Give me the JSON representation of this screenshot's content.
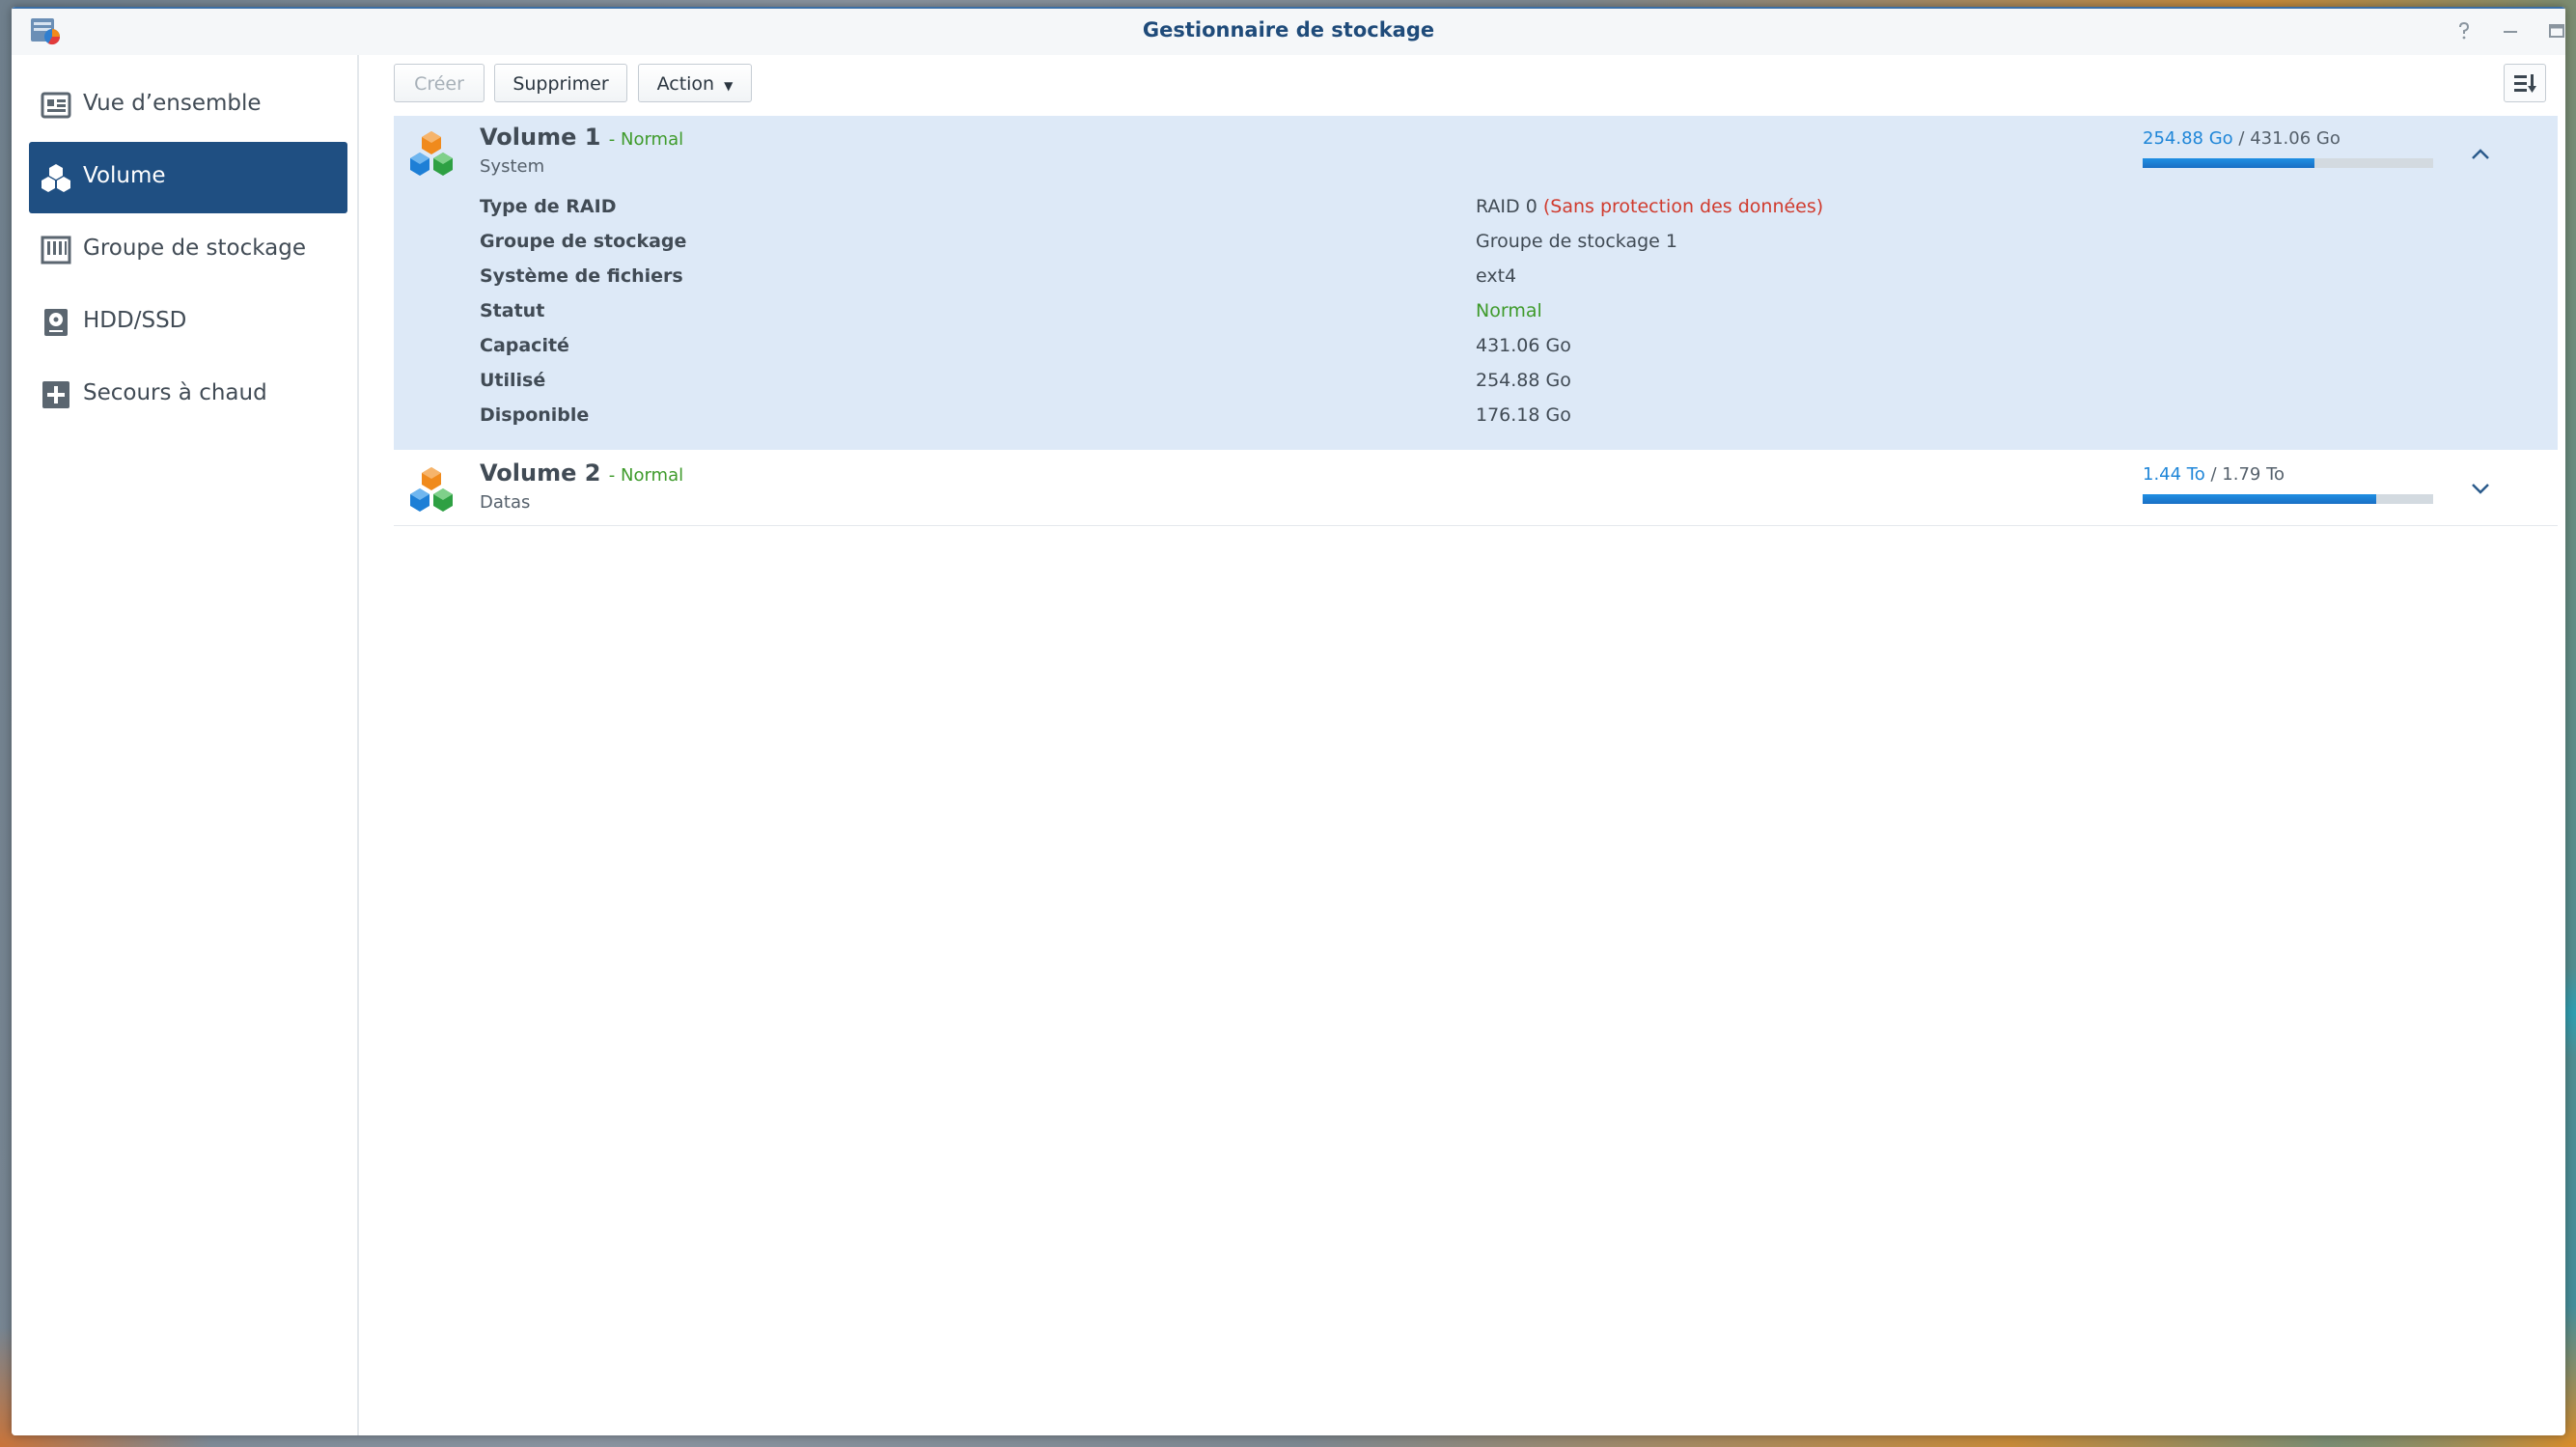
{
  "window": {
    "title": "Gestionnaire de stockage"
  },
  "sidebar": {
    "items": [
      {
        "label": "Vue d’ensemble",
        "icon": "overview-icon",
        "active": false
      },
      {
        "label": "Volume",
        "icon": "volume-cubes-icon",
        "active": true
      },
      {
        "label": "Groupe de stockage",
        "icon": "storage-pool-icon",
        "active": false
      },
      {
        "label": "HDD/SSD",
        "icon": "disk-icon",
        "active": false
      },
      {
        "label": "Secours à chaud",
        "icon": "hot-spare-plus-icon",
        "active": false
      }
    ]
  },
  "toolbar": {
    "create_label": "Créer",
    "delete_label": "Supprimer",
    "action_label": "Action"
  },
  "volumes": [
    {
      "name": "Volume 1",
      "status": "- Normal",
      "description": "System",
      "used": "254.88 Go",
      "separator": " / ",
      "total": "431.06 Go",
      "usage_fraction": 0.591,
      "expanded": true,
      "details": {
        "raid_type_label": "Type de RAID",
        "raid_type_value": "RAID 0",
        "raid_type_warning": "(Sans protection des données)",
        "pool_label": "Groupe de stockage",
        "pool_value": "Groupe de stockage 1",
        "fs_label": "Système de fichiers",
        "fs_value": "ext4",
        "status_label": "Statut",
        "status_value": "Normal",
        "capacity_label": "Capacité",
        "capacity_value": "431.06 Go",
        "used_label": "Utilisé",
        "used_value": "254.88 Go",
        "available_label": "Disponible",
        "available_value": "176.18 Go"
      }
    },
    {
      "name": "Volume 2",
      "status": "- Normal",
      "description": "Datas",
      "used": "1.44 To",
      "separator": " / ",
      "total": "1.79 To",
      "usage_fraction": 0.804,
      "expanded": false
    }
  ],
  "colors": {
    "accent": "#1f4f82",
    "status_ok": "#3f9b2c",
    "warning": "#d03b2e",
    "usage_fill": "#1f86d8"
  }
}
